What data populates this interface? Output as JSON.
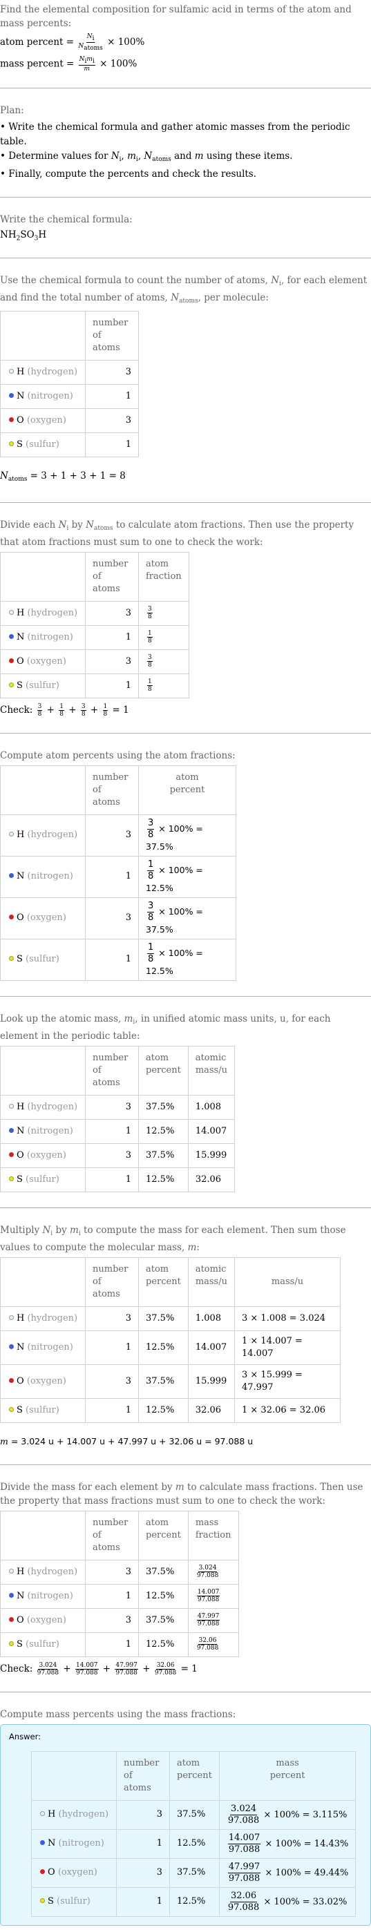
{
  "intro": {
    "title": "Find the elemental composition for sulfamic acid in terms of the atom and mass percents:",
    "atom_percent_label": "atom percent =",
    "atom_percent_num": "N",
    "atom_percent_num_sub": "i",
    "atom_percent_den": "N",
    "atom_percent_den_sub": "atoms",
    "times100": "× 100%",
    "mass_percent_label": "mass percent =",
    "mass_percent_num": "N",
    "mass_percent_num_sub": "i",
    "mass_percent_num2": "m",
    "mass_percent_num2_sub": "i",
    "mass_percent_den": "m"
  },
  "plan": {
    "heading": "Plan:",
    "items": [
      "Write the chemical formula and gather atomic masses from the periodic table.",
      "Determine values for N_i, m_i, N_atoms and m using these items.",
      "Finally, compute the percents and check the results."
    ],
    "item2_prefix": "Determine values for ",
    "item2_suffix": " and ",
    "item2_end": " using these items."
  },
  "formula": {
    "heading": "Write the chemical formula:",
    "parts": [
      "NH",
      "2",
      "SO",
      "3",
      "H"
    ]
  },
  "count": {
    "intro_a": "Use the chemical formula to count the number of atoms, ",
    "intro_b": ", for each element and find the total number of atoms, ",
    "intro_c": ", per molecule:",
    "total_eq": "= 3 + 1 + 3 + 1 = 8"
  },
  "headers": {
    "number_of_atoms": [
      "number",
      "of atoms"
    ],
    "atom_fraction": [
      "atom",
      "fraction"
    ],
    "atom_percent": [
      "atom",
      "percent"
    ],
    "atomic_mass": [
      "atomic",
      "mass/u"
    ],
    "mass": "mass/u",
    "mass_fraction": [
      "mass",
      "fraction"
    ],
    "mass_percent": [
      "mass",
      "percent"
    ]
  },
  "elements": [
    {
      "symbol": "H",
      "name": "(hydrogen)",
      "color": "#e8f8f8",
      "border": "#8a9a9a",
      "count": "3",
      "frac_num": "3",
      "frac_den": "8",
      "atom_percent_result": "× 100% = 37.5%",
      "atom_percent": "37.5%",
      "atomic_mass": "1.008",
      "mass_calc": "3 × 1.008 = 3.024",
      "mass": "3.024",
      "mass_percent_result": "× 100% = 3.115%"
    },
    {
      "symbol": "N",
      "name": "(nitrogen)",
      "color": "#3e5ed4",
      "border": "#3e5ed4",
      "count": "1",
      "frac_num": "1",
      "frac_den": "8",
      "atom_percent_result": "× 100% = 12.5%",
      "atom_percent": "12.5%",
      "atomic_mass": "14.007",
      "mass_calc": "1 × 14.007 = 14.007",
      "mass": "14.007",
      "mass_percent_result": "× 100% = 14.43%"
    },
    {
      "symbol": "O",
      "name": "(oxygen)",
      "color": "#cc2222",
      "border": "#cc2222",
      "count": "3",
      "frac_num": "3",
      "frac_den": "8",
      "atom_percent_result": "× 100% = 37.5%",
      "atom_percent": "37.5%",
      "atomic_mass": "15.999",
      "mass_calc": "3 × 15.999 = 47.997",
      "mass": "47.997",
      "mass_percent_result": "× 100% = 49.44%"
    },
    {
      "symbol": "S",
      "name": "(sulfur)",
      "color": "#e8e820",
      "border": "#a0a020",
      "count": "1",
      "frac_num": "1",
      "frac_den": "8",
      "atom_percent_result": "× 100% = 12.5%",
      "atom_percent": "12.5%",
      "atomic_mass": "32.06",
      "mass_calc": "1 × 32.06 = 32.06",
      "mass": "32.06",
      "mass_percent_result": "× 100% = 33.02%"
    }
  ],
  "fractions": {
    "intro_a": "Divide each ",
    "intro_b": " by ",
    "intro_c": " to calculate atom fractions. Then use the property that atom fractions must sum to one to check the work:",
    "check_label": "Check:",
    "check_result": "= 1"
  },
  "atom_percents": {
    "intro": "Compute atom percents using the atom fractions:"
  },
  "atomic_masses": {
    "intro_a": "Look up the atomic mass, ",
    "intro_b": ", in unified atomic mass units, u, for each element in the periodic table:"
  },
  "molecular_mass": {
    "intro_a": "Multiply ",
    "intro_b": " by ",
    "intro_c": " to compute the mass for each element. Then sum those values to compute the molecular mass, ",
    "intro_d": ":",
    "equation": "= 3.024 u + 14.007 u + 47.997 u + 32.06 u = 97.088 u"
  },
  "mass_fractions": {
    "intro_a": "Divide the mass for each element by ",
    "intro_b": " to calculate mass fractions. Then use the property that mass fractions must sum to one to check the work:",
    "denominator": "97.088",
    "check_label": "Check:",
    "check_result": "= 1"
  },
  "mass_percents": {
    "intro": "Compute mass percents using the mass fractions:",
    "answer_label": "Answer:"
  },
  "symbols": {
    "N": "N",
    "m": "m",
    "i": "i",
    "atoms": "atoms",
    "plus": "+",
    "comma": ", "
  }
}
